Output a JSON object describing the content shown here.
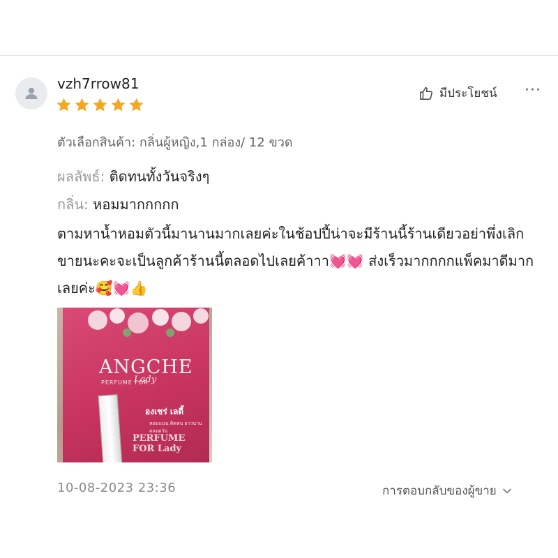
{
  "review": {
    "username": "vzh7rrow81",
    "rating": 5,
    "helpful_label": "มีประโยชน์",
    "more_label": "···",
    "variation": "ตัวเลือกสินค้า: กลิ่นผู้หญิง,1 กล่อง/ 12 ขวด",
    "result_label": "ผลลัพธ์:",
    "result_value": "ติดทนทั้งวันจริงๆ",
    "scent_label": "กลิ่น:",
    "scent_value": "หอมมากกกกก",
    "body": "ตามหาน้ำหอมตัวนี้มานานมากเลยค่ะในช้อปปี้น่าจะมีร้านนี้ร้านเดียวอย่าพึ่งเลิกขายนะคะจะเป็นลูกค้าร้านนี้ตลอดไปเลยค้าาา💓💓 ส่งเร็วมากกกกแพ็คมาดีมากเลยค่ะ🥰💓👍",
    "photo": {
      "brand": "ANGCHE",
      "brand_sub": "PERFUME FOR",
      "brand_script": "Lady",
      "thai_name": "องเชร่ เลดี้",
      "thai_sub": "หอมแนน ติดทน ยาวนาน ตลอดวัน",
      "perfume_text": "PERFUME FOR Lady"
    },
    "date": "10-08-2023 23:36",
    "seller_reply_label": "การตอบกลับของผู้ขาย"
  },
  "colors": {
    "star": "#f5a623",
    "divider": "#e3e3e3",
    "box_pink": "#c7345f"
  },
  "icons": [
    "user-avatar-icon",
    "star-icon",
    "thumbs-up-icon",
    "more-icon",
    "chevron-down-icon"
  ]
}
